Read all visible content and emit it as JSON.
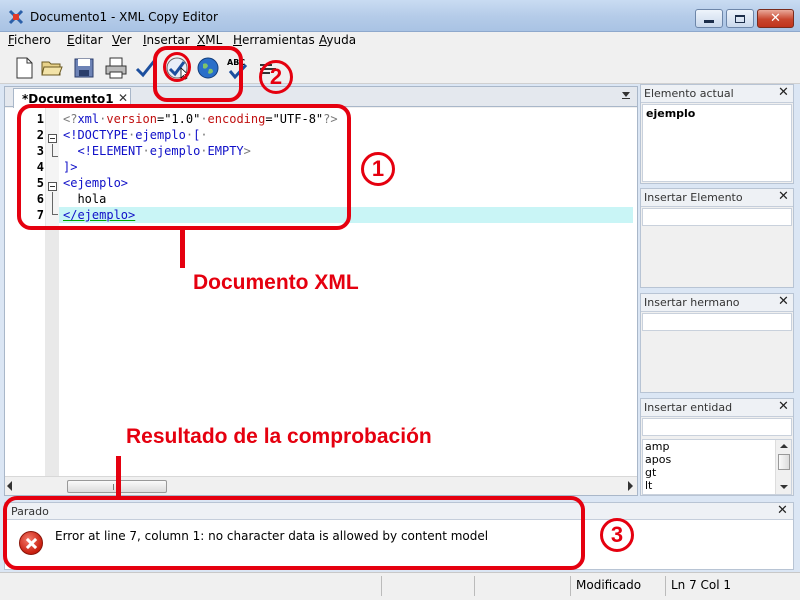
{
  "window": {
    "title": "Documento1 - XML Copy Editor"
  },
  "menu": {
    "items": [
      {
        "acc": "F",
        "rest": "ichero"
      },
      {
        "acc": "E",
        "rest": "ditar"
      },
      {
        "acc": "V",
        "rest": "er"
      },
      {
        "acc": "I",
        "rest": "nsertar"
      },
      {
        "acc": "X",
        "rest": "ML"
      },
      {
        "acc": "H",
        "rest": "erramientas"
      },
      {
        "acc": "A",
        "rest": "yuda"
      }
    ]
  },
  "toolbar": {
    "icons": [
      "new-document-icon",
      "open-folder-icon",
      "save-icon",
      "print-icon",
      "check-wellformed-icon",
      "validate-icon",
      "browser-icon",
      "spellcheck-icon",
      "pretty-print-icon"
    ]
  },
  "editor": {
    "tab_label": "*Documento1",
    "tab_close": "✕",
    "lines": [
      {
        "num": "1",
        "parts": [
          [
            "<?",
            "gray"
          ],
          [
            "xml",
            "blue"
          ],
          [
            "·",
            "gray"
          ],
          [
            "version",
            "red"
          ],
          [
            "=",
            "black"
          ],
          [
            "\"1.0\"",
            "black"
          ],
          [
            "·",
            "gray"
          ],
          [
            "encoding",
            "red"
          ],
          [
            "=",
            "black"
          ],
          [
            "\"UTF-8\"",
            "black"
          ],
          [
            "?>",
            "gray"
          ]
        ]
      },
      {
        "num": "2",
        "parts": [
          [
            "<!DOCTYPE",
            "blue"
          ],
          [
            "·",
            "gray"
          ],
          [
            "ejemplo",
            "blue"
          ],
          [
            "·",
            "gray"
          ],
          [
            "[",
            "blue"
          ],
          [
            "·",
            "gray"
          ]
        ]
      },
      {
        "num": "3",
        "parts": [
          [
            "  ",
            "black"
          ],
          [
            "<!ELEMENT",
            "blue"
          ],
          [
            "·",
            "gray"
          ],
          [
            "ejemplo",
            "blue"
          ],
          [
            "·",
            "gray"
          ],
          [
            "EMPTY",
            "blue"
          ],
          [
            ">",
            "gray"
          ]
        ]
      },
      {
        "num": "4",
        "parts": [
          [
            "]>",
            "blue"
          ]
        ]
      },
      {
        "num": "5",
        "parts": [
          [
            "<ejemplo>",
            "blue"
          ]
        ]
      },
      {
        "num": "6",
        "parts": [
          [
            "  hola",
            "black"
          ]
        ]
      },
      {
        "num": "7",
        "parts": [
          [
            "</ejemplo>",
            "blue-underline"
          ]
        ]
      }
    ]
  },
  "panels": {
    "current_element": {
      "title": "Elemento actual",
      "value": "ejemplo",
      "close": "✕"
    },
    "insert_element": {
      "title": "Insertar Elemento",
      "close": "✕"
    },
    "insert_sibling": {
      "title": "Insertar hermano",
      "close": "✕"
    },
    "insert_entity": {
      "title": "Insertar entidad",
      "close": "✕",
      "items": [
        "amp",
        "apos",
        "gt",
        "lt"
      ]
    }
  },
  "output": {
    "title": "Parado",
    "close": "✕",
    "message": "Error at line 7, column 1: no character data is allowed by content model"
  },
  "status": {
    "modified": "Modificado",
    "position": "Ln 7 Col 1"
  },
  "annotations": {
    "num1": "1",
    "num2": "2",
    "num3": "3",
    "label_document": "Documento XML",
    "label_result": "Resultado de la comprobación"
  },
  "colors": {
    "annotation": "#e5000f",
    "current_line": "#c9f5f6",
    "xml_tag": "#1010c8",
    "xml_attr": "#c01010"
  }
}
